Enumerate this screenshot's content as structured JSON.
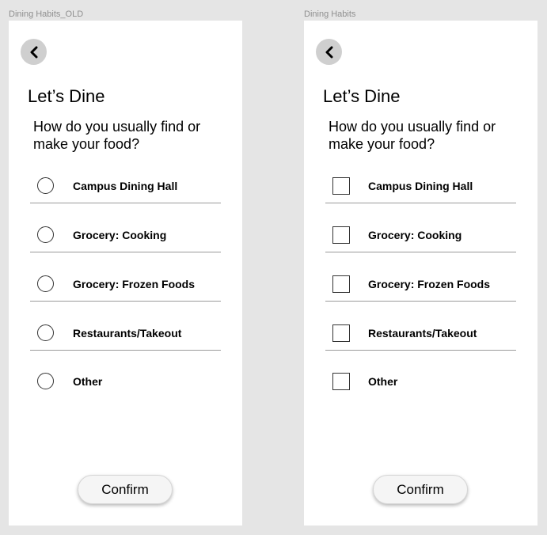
{
  "frames": [
    {
      "label": "Dining Habits_OLD",
      "title": "Let’s Dine",
      "question": "How do you usually find or make your food?",
      "options": [
        {
          "label": "Campus Dining Hall",
          "control": "radio"
        },
        {
          "label": "Grocery: Cooking",
          "control": "radio"
        },
        {
          "label": "Grocery: Frozen Foods",
          "control": "radio"
        },
        {
          "label": "Restaurants/Takeout",
          "control": "radio"
        },
        {
          "label": "Other",
          "control": "radio"
        }
      ],
      "confirm_label": "Confirm"
    },
    {
      "label": "Dining Habits",
      "title": "Let’s Dine",
      "question": "How do you usually find or make your food?",
      "options": [
        {
          "label": "Campus Dining Hall",
          "control": "checkbox"
        },
        {
          "label": "Grocery: Cooking",
          "control": "checkbox"
        },
        {
          "label": "Grocery: Frozen Foods",
          "control": "checkbox"
        },
        {
          "label": "Restaurants/Takeout",
          "control": "checkbox"
        },
        {
          "label": "Other",
          "control": "checkbox"
        }
      ],
      "confirm_label": "Confirm"
    }
  ],
  "icons": {
    "back": "chevron-left-icon"
  },
  "colors": {
    "canvas": "#e5e5e5",
    "frame": "#ffffff",
    "back_button": "#cfcfcf",
    "divider": "#9a9a9a",
    "frame_label": "#8f8f8f"
  }
}
